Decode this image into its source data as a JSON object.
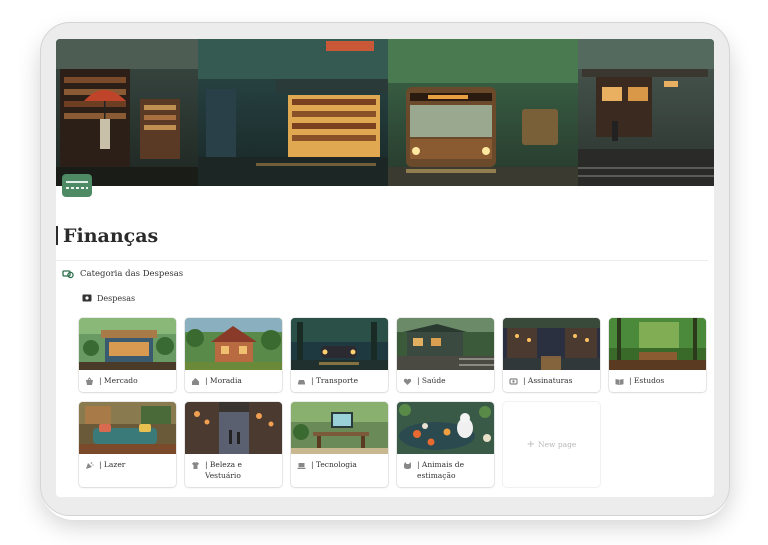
{
  "page": {
    "title": "Finanças",
    "icon": "credit-card-icon",
    "cover": "rainy-city-collage"
  },
  "section": {
    "label": "Categoria das Despesas",
    "icon": "money-exchange-icon"
  },
  "database": {
    "label": "Despesas",
    "icon": "wallet-icon"
  },
  "cards": [
    {
      "label": "| Mercado",
      "icon": "shopping-basket-icon"
    },
    {
      "label": "| Moradia",
      "icon": "house-icon"
    },
    {
      "label": "| Transporte",
      "icon": "car-icon"
    },
    {
      "label": "| Saúde",
      "icon": "heart-hands-icon"
    },
    {
      "label": "| Assinaturas",
      "icon": "subscriptions-icon"
    },
    {
      "label": "| Estudos",
      "icon": "open-book-icon"
    },
    {
      "label": "| Lazer",
      "icon": "party-icon"
    },
    {
      "label": "| Beleza e Vestuário",
      "icon": "shirt-icon"
    },
    {
      "label": "| Tecnologia",
      "icon": "laptop-icon"
    },
    {
      "label": "| Animais de estimação",
      "icon": "dog-icon"
    }
  ],
  "new_page": {
    "label": "New page",
    "icon": "plus-icon"
  }
}
